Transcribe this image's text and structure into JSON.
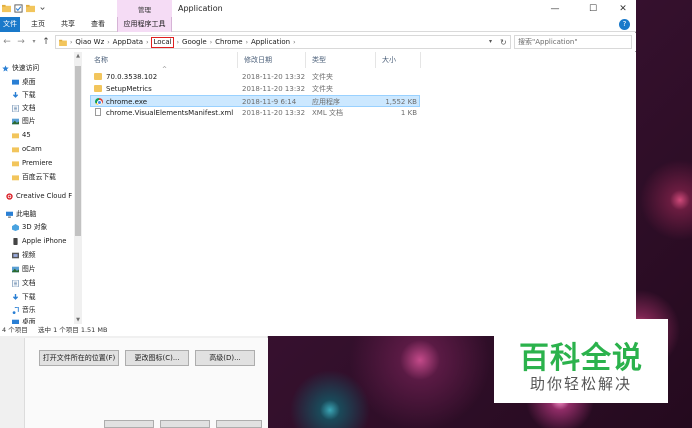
{
  "window": {
    "title": "Application",
    "context_tab": "管理",
    "controls": {
      "minimize": "—",
      "maximize": "☐",
      "close": "✕"
    }
  },
  "ribbon": {
    "tabs": [
      "文件",
      "主页",
      "共享",
      "查看",
      "应用程序工具"
    ],
    "help": "?"
  },
  "address": {
    "back": "←",
    "forward": "→",
    "up": "↑",
    "crumbs": [
      "Qiao Wz",
      "AppData",
      "Local",
      "Google",
      "Chrome",
      "Application"
    ],
    "search_placeholder": "搜索\"Application\""
  },
  "nav": {
    "quick_access": "快速访问",
    "quick_items": [
      {
        "label": "桌面",
        "pinned": true
      },
      {
        "label": "下载",
        "pinned": true
      },
      {
        "label": "文档",
        "pinned": true
      },
      {
        "label": "图片",
        "pinned": true
      },
      {
        "label": "45",
        "pinned": false
      },
      {
        "label": "oCam",
        "pinned": false
      },
      {
        "label": "Premiere",
        "pinned": false
      },
      {
        "label": "百度云下载",
        "pinned": false
      }
    ],
    "creative_cloud": "Creative Cloud F",
    "this_pc": "此电脑",
    "pc_items": [
      "3D 对象",
      "Apple iPhone",
      "视频",
      "图片",
      "文档",
      "下载",
      "音乐",
      "桌面"
    ]
  },
  "filelist": {
    "columns": [
      "名称",
      "修改日期",
      "类型",
      "大小"
    ],
    "rows": [
      {
        "name": "70.0.3538.102",
        "date": "2018-11-20 13:32",
        "type": "文件夹",
        "size": "",
        "icon": "folder-icon",
        "selected": false
      },
      {
        "name": "SetupMetrics",
        "date": "2018-11-20 13:32",
        "type": "文件夹",
        "size": "",
        "icon": "folder-icon",
        "selected": false
      },
      {
        "name": "chrome.exe",
        "date": "2018-11-9 6:14",
        "type": "应用程序",
        "size": "1,552 KB",
        "icon": "chrome-icon",
        "selected": true
      },
      {
        "name": "chrome.VisualElementsManifest.xml",
        "date": "2018-11-20 13:32",
        "type": "XML 文档",
        "size": "1 KB",
        "icon": "document-icon",
        "selected": false
      }
    ]
  },
  "status": {
    "count": "4 个项目",
    "selection": "选中 1 个项目  1.51 MB"
  },
  "background_dialog": {
    "buttons": [
      "打开文件所在的位置(F)",
      "更改图标(C)...",
      "高级(D)..."
    ]
  },
  "watermark": {
    "title": "百科全说",
    "subtitle": "助你轻松解决"
  },
  "colors": {
    "file_tab": "#1979ca",
    "context_tab": "#f5dcf5",
    "selection": "#cce8ff",
    "watermark_green": "#2bb24c",
    "highlight_red": "#e02020"
  }
}
